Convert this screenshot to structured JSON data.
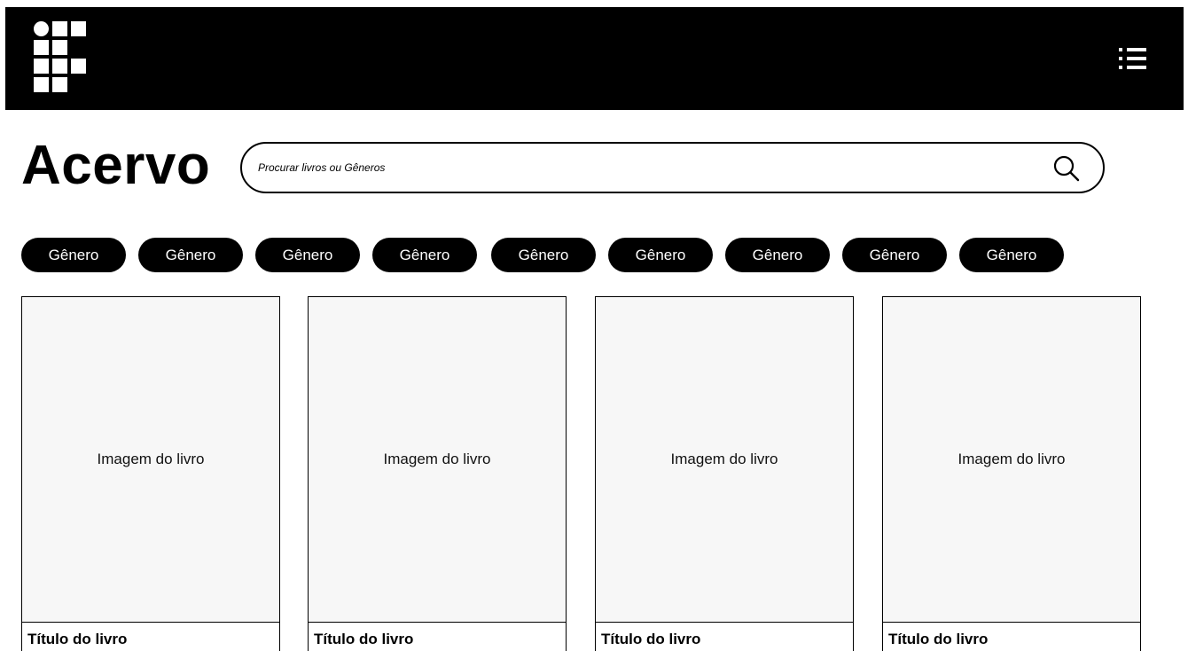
{
  "header": {
    "logo_icon": "institute-logo-icon",
    "menu_icon": "menu-list-icon"
  },
  "page": {
    "title": "Acervo"
  },
  "search": {
    "placeholder": "Procurar livros ou Gêneros",
    "icon": "search-icon"
  },
  "genres": [
    {
      "label": "Gênero"
    },
    {
      "label": "Gênero"
    },
    {
      "label": "Gênero"
    },
    {
      "label": "Gênero"
    },
    {
      "label": "Gênero"
    },
    {
      "label": "Gênero"
    },
    {
      "label": "Gênero"
    },
    {
      "label": "Gênero"
    },
    {
      "label": "Gênero"
    }
  ],
  "books": [
    {
      "image_label": "Imagem do livro",
      "title": "Título do livro"
    },
    {
      "image_label": "Imagem do livro",
      "title": "Título do livro"
    },
    {
      "image_label": "Imagem do livro",
      "title": "Título do livro"
    },
    {
      "image_label": "Imagem do livro",
      "title": "Título do livro"
    }
  ],
  "colors": {
    "header_bg": "#000000",
    "chip_bg": "#000000",
    "chip_text": "#ffffff",
    "card_image_bg": "#f7f7f7"
  }
}
